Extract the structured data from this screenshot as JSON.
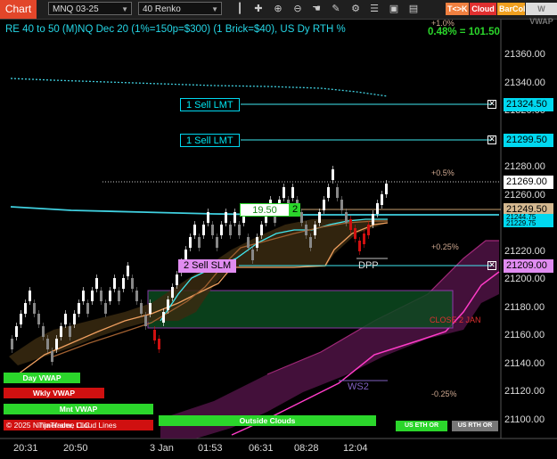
{
  "toolbar": {
    "chart_label": "Chart",
    "instrument": "MNQ 03-25",
    "bar_type": "40 Renko",
    "tags": {
      "tk": "T<>K",
      "cloud": "Cloud",
      "barcol": "BarCol",
      "vwap": "W VWAP"
    }
  },
  "header": {
    "title": "RE 40 to 50 (M)NQ Dec 20 (1%=150p=$300) (1 Brick=$40), US Dy RTH %",
    "plus1": "+1.0%",
    "pct_change": "0.48% = 101.50"
  },
  "orders": [
    {
      "label": "1 Sell LMT",
      "price": "21324.50"
    },
    {
      "label": "1 Sell LMT",
      "price": "21299.50"
    },
    {
      "label": "2 Sell SLM",
      "price": "21209.00"
    }
  ],
  "price_boxes": {
    "last": "21269.00",
    "avg": "21249.50",
    "overlap1": "21244.75",
    "overlap2": "21229.75"
  },
  "position_tag": {
    "value": "19.50",
    "qty": "2"
  },
  "y_axis": [
    "21360.00",
    "21340.00",
    "21320.00",
    "21300.00",
    "21280.00",
    "21260.00",
    "21240.00",
    "21220.00",
    "21200.00",
    "21180.00",
    "21160.00",
    "21140.00",
    "21120.00",
    "21100.00"
  ],
  "x_axis": [
    "20:31",
    "20:50",
    "3 Jan",
    "01:53",
    "06:31",
    "08:28",
    "12:04"
  ],
  "annotations": {
    "p05": "+0.5%",
    "p025": "+0.25%",
    "m025": "-0.25%",
    "dpp": "DPP",
    "close2jan": "CLOSE 2 JAN",
    "ws2": "WS2"
  },
  "legend": {
    "day_vwap": "Day VWAP",
    "wkly_vwap": "Wkly VWAP",
    "mnt_vwap": "Mnt VWAP",
    "copyright": "© 2025 NinjaTrader, LLC",
    "tf_lines": "Timeframe Cloud Lines",
    "outside_clouds": "Outside Clouds",
    "us_eth_or": "US ETH OR",
    "us_rth_or": "US RTH OR"
  },
  "colors": {
    "accent_cyan": "#00e5f0",
    "bull_brick": "#ffffff",
    "bear_brick": "#d01010",
    "cloud_purple": "#5a1a4a",
    "order_box": "#00d8f0",
    "sell_slm": "#e08cf0"
  },
  "icons": [
    "bars-icon",
    "crosshair-icon",
    "zoom-in-icon",
    "zoom-out-icon",
    "hand-icon",
    "pencil-icon",
    "gear-icon",
    "list-icon",
    "lock-icon",
    "window-icon"
  ]
}
